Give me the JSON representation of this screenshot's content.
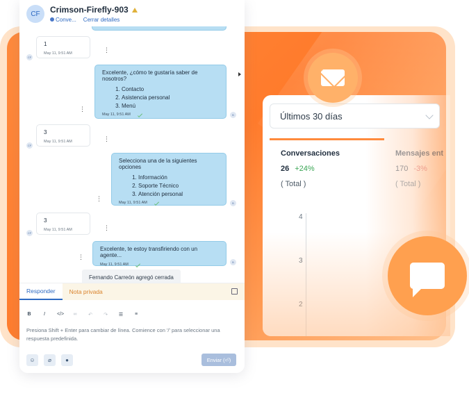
{
  "conversation": {
    "avatar_initials": "CF",
    "title": "Crimson-Firefly-903",
    "inbox_label": "Conve...",
    "close_details_label": "Cerrar detalles"
  },
  "messages": [
    {
      "direction": "in",
      "text": "1",
      "time": "May 11, 9:51 AM"
    },
    {
      "direction": "out",
      "text": "Excelente, ¿cómo te gustaría saber de nosotros?",
      "options": [
        "Contacto",
        "Asistencia personal",
        "Menú"
      ],
      "time": "May 11, 9:51 AM"
    },
    {
      "direction": "in",
      "text": "3",
      "time": "May 11, 9:51 AM"
    },
    {
      "direction": "out",
      "text": "Selecciona una de la siguientes opciones",
      "options": [
        "Información",
        "Soporte Técnico",
        "Atención personal"
      ],
      "time": "May 11, 9:51 AM"
    },
    {
      "direction": "in",
      "text": "3",
      "time": "May 11, 9:51 AM"
    },
    {
      "direction": "out",
      "text": "Excelente, te estoy transfiriendo con un agente...",
      "options": [],
      "time": "May 11, 9:51 AM"
    }
  ],
  "activity": "Fernando Carreón agregó cerrada",
  "reply": {
    "tab_reply": "Responder",
    "tab_private": "Nota privada",
    "format": {
      "bold": "B",
      "italic": "I",
      "code": "</>",
      "link": "∞",
      "undo": "↶",
      "redo": "↷",
      "bullets": "☰",
      "numbered": "≡"
    },
    "placeholder": "Presiona Shift + Enter para cambiar de línea. Comience con '/' para seleccionar una respuesta predefinida.",
    "send_label": "Enviar (⏎)"
  },
  "stats": {
    "period": "Últimos 30 días",
    "metrics": [
      {
        "label": "Conversaciones",
        "count": "26",
        "delta": "+24%",
        "total": "( Total )"
      },
      {
        "label": "Mensajes ent",
        "count": "170",
        "delta": "-3%",
        "total": "( Total )"
      }
    ],
    "axis_ticks": [
      "4",
      "3",
      "2"
    ]
  },
  "colors": {
    "accent_blue": "#2e6ac2",
    "bubble_out": "#b7def3",
    "orange": "#ff8a3c",
    "delta_up": "#3aa655"
  },
  "icons": {
    "mail": "mail-icon",
    "chat": "chat-icon"
  }
}
